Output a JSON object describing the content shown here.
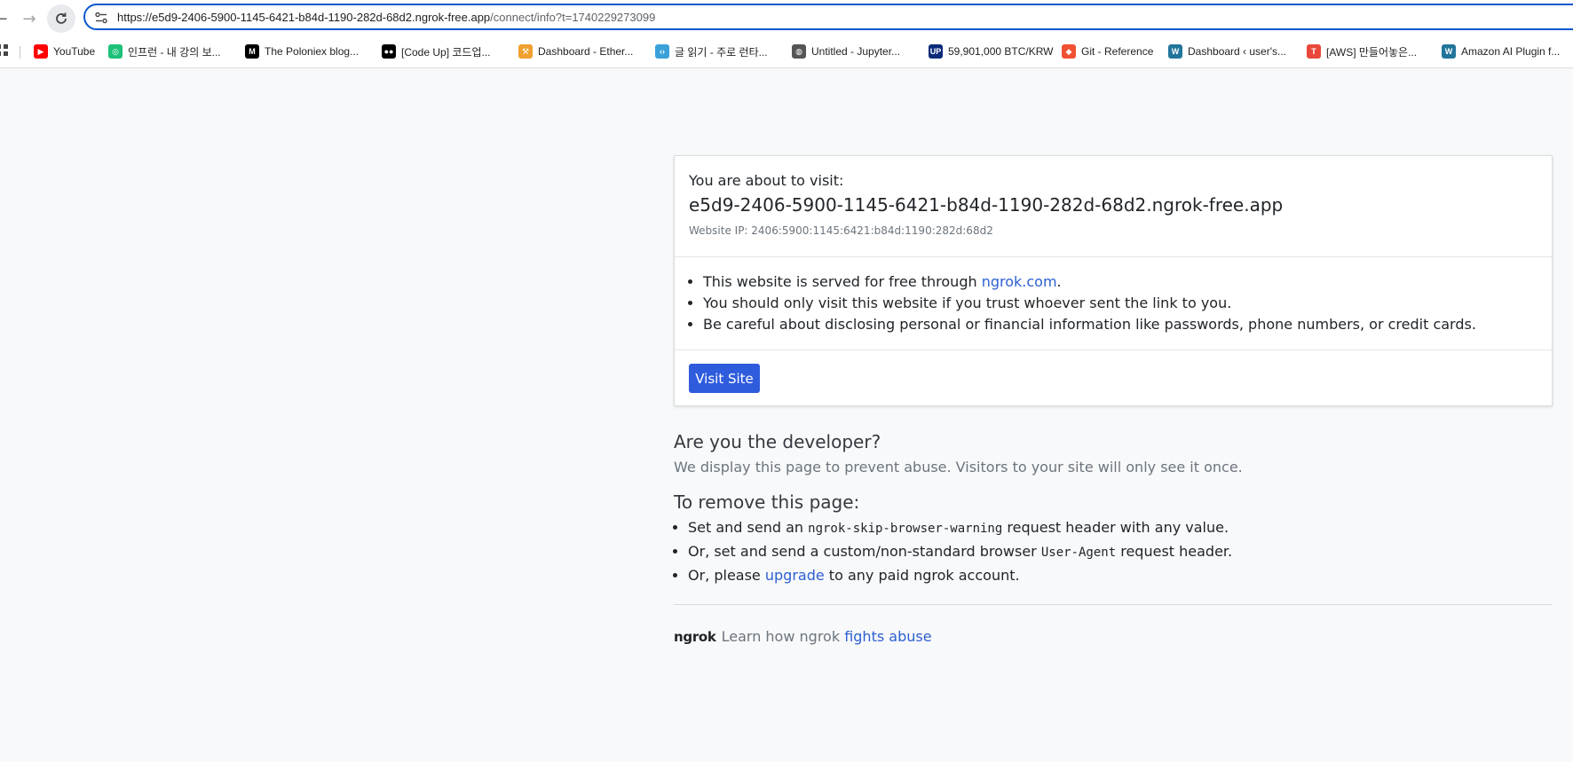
{
  "browser": {
    "url_host": "https://e5d9-2406-5900-1145-6421-b84d-1190-282d-68d2.ngrok-free.app",
    "url_path": "/connect/info?t=1740229273099",
    "bookmarks": [
      {
        "label": "YouTube",
        "icon": "youtube-icon",
        "color": "#ff0000",
        "glyph": "▶"
      },
      {
        "label": "인프런 - 내 강의 보...",
        "icon": "inflearn-icon",
        "color": "#1dc078",
        "glyph": "◎"
      },
      {
        "label": "The Poloniex blog...",
        "icon": "medium-icon",
        "color": "#000000",
        "glyph": "M"
      },
      {
        "label": "[Code Up] 코드업...",
        "icon": "codeup-icon",
        "color": "#000000",
        "glyph": "●●"
      },
      {
        "label": "Dashboard - Ether...",
        "icon": "ethereum-tools-icon",
        "color": "#f0a030",
        "glyph": "⚒"
      },
      {
        "label": "글 읽기 - 주로 런타...",
        "icon": "code-brackets-icon",
        "color": "#3aa0d8",
        "glyph": "‹›"
      },
      {
        "label": "Untitled - Jupyter...",
        "icon": "globe-icon",
        "color": "#555555",
        "glyph": "◍"
      },
      {
        "label": "59,901,000 BTC/KRW",
        "icon": "upbit-icon",
        "color": "#0a2a7a",
        "glyph": "UP"
      },
      {
        "label": "Git - Reference",
        "icon": "git-icon",
        "color": "#f05133",
        "glyph": "◆"
      },
      {
        "label": "Dashboard ‹ user's...",
        "icon": "wordpress-icon",
        "color": "#21759b",
        "glyph": "W"
      },
      {
        "label": "[AWS] 만들어놓은...",
        "icon": "aws-blog-icon",
        "color": "#e8473a",
        "glyph": "T"
      },
      {
        "label": "Amazon AI Plugin f...",
        "icon": "wordpress-icon",
        "color": "#21759b",
        "glyph": "W"
      }
    ]
  },
  "card": {
    "about_label": "You are about to visit:",
    "host": "e5d9-2406-5900-1145-6421-b84d-1190-282d-68d2.ngrok-free.app",
    "website_ip": "Website IP: 2406:5900:1145:6421:b84d:1190:282d:68d2",
    "warn1_prefix": "This website is served for free through ",
    "warn1_link": "ngrok.com",
    "warn1_suffix": ".",
    "warn2": "You should only visit this website if you trust whoever sent the link to you.",
    "warn3": "Be careful about disclosing personal or financial information like passwords, phone numbers, or credit cards.",
    "visit_button": "Visit Site"
  },
  "developer": {
    "title": "Are you the developer?",
    "text": "We display this page to prevent abuse. Visitors to your site will only see it once.",
    "remove_title": "To remove this page:",
    "item1_prefix": "Set and send an ",
    "item1_code": "ngrok-skip-browser-warning",
    "item1_suffix": " request header with any value.",
    "item2_prefix": "Or, set and send a custom/non-standard browser ",
    "item2_code": "User-Agent",
    "item2_suffix": " request header.",
    "item3_prefix": "Or, please ",
    "item3_link": "upgrade",
    "item3_suffix": " to any paid ngrok account."
  },
  "footer": {
    "logo": "ngrok",
    "prefix": "Learn how ngrok ",
    "link": "fights abuse"
  }
}
